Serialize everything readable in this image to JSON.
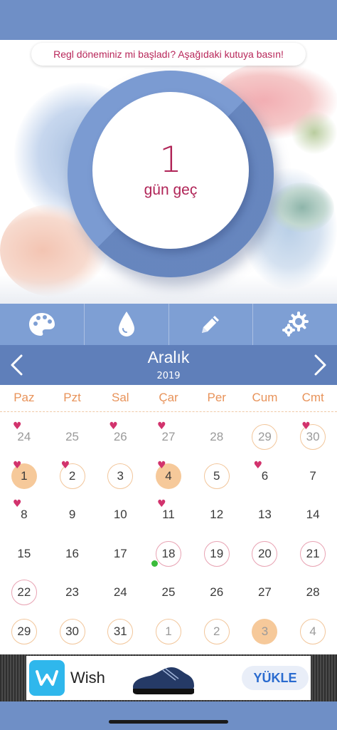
{
  "banner": {
    "text": "Regl döneminiz mi başladı? Aşağıdaki kutuya basın!"
  },
  "dial": {
    "number": "1",
    "unit": "gün geç"
  },
  "toolbar": {
    "items": [
      {
        "icon": "palette-icon"
      },
      {
        "icon": "drop-icon"
      },
      {
        "icon": "pencil-icon"
      },
      {
        "icon": "gears-icon"
      }
    ]
  },
  "calendar": {
    "month": "Aralık",
    "year": "2019",
    "weekdays": [
      "Paz",
      "Pzt",
      "Sal",
      "Çar",
      "Per",
      "Cum",
      "Cmt"
    ],
    "weeks": [
      [
        {
          "d": "24",
          "dim": true,
          "heart": true
        },
        {
          "d": "25",
          "dim": true
        },
        {
          "d": "26",
          "dim": true,
          "heart": true
        },
        {
          "d": "27",
          "dim": true,
          "heart": true
        },
        {
          "d": "28",
          "dim": true
        },
        {
          "d": "29",
          "dim": true,
          "mark": "ring-orange"
        },
        {
          "d": "30",
          "dim": true,
          "heart": true,
          "mark": "ring-orange"
        }
      ],
      [
        {
          "d": "1",
          "heart": true,
          "mark": "fill-orange"
        },
        {
          "d": "2",
          "heart": true,
          "mark": "ring-orange"
        },
        {
          "d": "3",
          "mark": "ring-orange"
        },
        {
          "d": "4",
          "heart": true,
          "mark": "fill-orange"
        },
        {
          "d": "5",
          "mark": "ring-orange"
        },
        {
          "d": "6",
          "heart": true
        },
        {
          "d": "7"
        }
      ],
      [
        {
          "d": "8",
          "heart": true
        },
        {
          "d": "9"
        },
        {
          "d": "10"
        },
        {
          "d": "11",
          "heart": true
        },
        {
          "d": "12"
        },
        {
          "d": "13"
        },
        {
          "d": "14"
        }
      ],
      [
        {
          "d": "15"
        },
        {
          "d": "16"
        },
        {
          "d": "17"
        },
        {
          "d": "18",
          "mark": "ring-pink",
          "today": true
        },
        {
          "d": "19",
          "mark": "ring-pink"
        },
        {
          "d": "20",
          "mark": "ring-pink"
        },
        {
          "d": "21",
          "mark": "ring-pink"
        }
      ],
      [
        {
          "d": "22",
          "mark": "ring-pink"
        },
        {
          "d": "23"
        },
        {
          "d": "24"
        },
        {
          "d": "25"
        },
        {
          "d": "26"
        },
        {
          "d": "27"
        },
        {
          "d": "28"
        }
      ],
      [
        {
          "d": "29",
          "mark": "ring-orange"
        },
        {
          "d": "30",
          "mark": "ring-orange"
        },
        {
          "d": "31",
          "mark": "ring-orange"
        },
        {
          "d": "1",
          "dim": true,
          "mark": "ring-orange"
        },
        {
          "d": "2",
          "dim": true,
          "mark": "ring-orange"
        },
        {
          "d": "3",
          "dim": true,
          "mark": "fill-orange"
        },
        {
          "d": "4",
          "dim": true,
          "mark": "ring-orange"
        }
      ]
    ]
  },
  "ad": {
    "brand": "Wish",
    "cta": "YÜKLE"
  },
  "colors": {
    "accent": "#6f8fc6",
    "month_bar": "#5f7fba",
    "period": "#b02457",
    "weekday": "#e8935a"
  }
}
